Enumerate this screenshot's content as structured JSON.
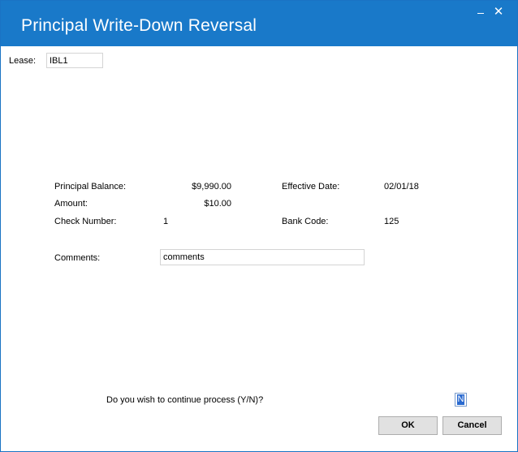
{
  "window": {
    "title": "Principal Write-Down Reversal",
    "minimize_label": "_",
    "close_label": "✕"
  },
  "lease": {
    "label": "Lease:",
    "value": "IBL1"
  },
  "details": {
    "principal_balance_label": "Principal Balance:",
    "principal_balance_value": "$9,990.00",
    "amount_label": "Amount:",
    "amount_value": "$10.00",
    "check_number_label": "Check Number:",
    "check_number_value": "1",
    "effective_date_label": "Effective Date:",
    "effective_date_value": "02/01/18",
    "bank_code_label": "Bank Code:",
    "bank_code_value": "125"
  },
  "comments": {
    "label": "Comments:",
    "value": "comments"
  },
  "prompt": {
    "text": "Do you wish to continue process (Y/N)?",
    "answer": "N"
  },
  "buttons": {
    "ok_label": "OK",
    "cancel_label": "Cancel"
  }
}
